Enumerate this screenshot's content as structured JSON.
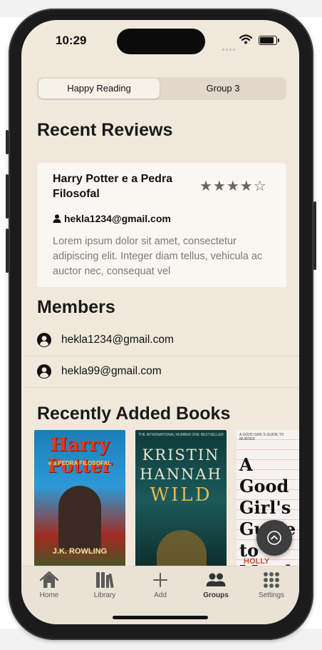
{
  "status": {
    "time": "10:29"
  },
  "segments": [
    "Happy Reading",
    "Group 3"
  ],
  "reviews": {
    "heading": "Recent Reviews",
    "item": {
      "title": "Harry Potter e a Pedra Filosofal",
      "rating": 4,
      "rating_max": 5,
      "stars_text": "★★★★☆",
      "reviewer": "hekla1234@gmail.com",
      "text": "Lorem ipsum dolor sit amet, consectetur adipiscing elit. Integer diam tellus, vehicula ac auctor nec, consequat vel"
    }
  },
  "members": {
    "heading": "Members",
    "items": [
      "hekla1234@gmail.com",
      "hekla99@gmail.com"
    ]
  },
  "books": {
    "heading": "Recently Added Books",
    "covers": [
      {
        "title": "Harry Potter",
        "subtitle": "e a PEDRA FILOSOFAL",
        "author": "J.K. ROWLING"
      },
      {
        "top": "THE INTERNATIONAL NUMBER ONE BESTSELLER",
        "author": "KRISTIN HANNAH",
        "title": "WILD"
      },
      {
        "top": "A GOOD GIRL'S GUIDE TO MURDER",
        "title": "A Good Girl's Guide to Murder",
        "author": "HOLLY JACKSON"
      }
    ]
  },
  "tabs": [
    "Home",
    "Library",
    "Add",
    "Groups",
    "Settings"
  ],
  "active_tab": "Groups",
  "colors": {
    "background": "#f1e8dc",
    "card": "#faf7f3",
    "tabbar": "#ebe2d6",
    "fab": "#3e3e3e"
  }
}
